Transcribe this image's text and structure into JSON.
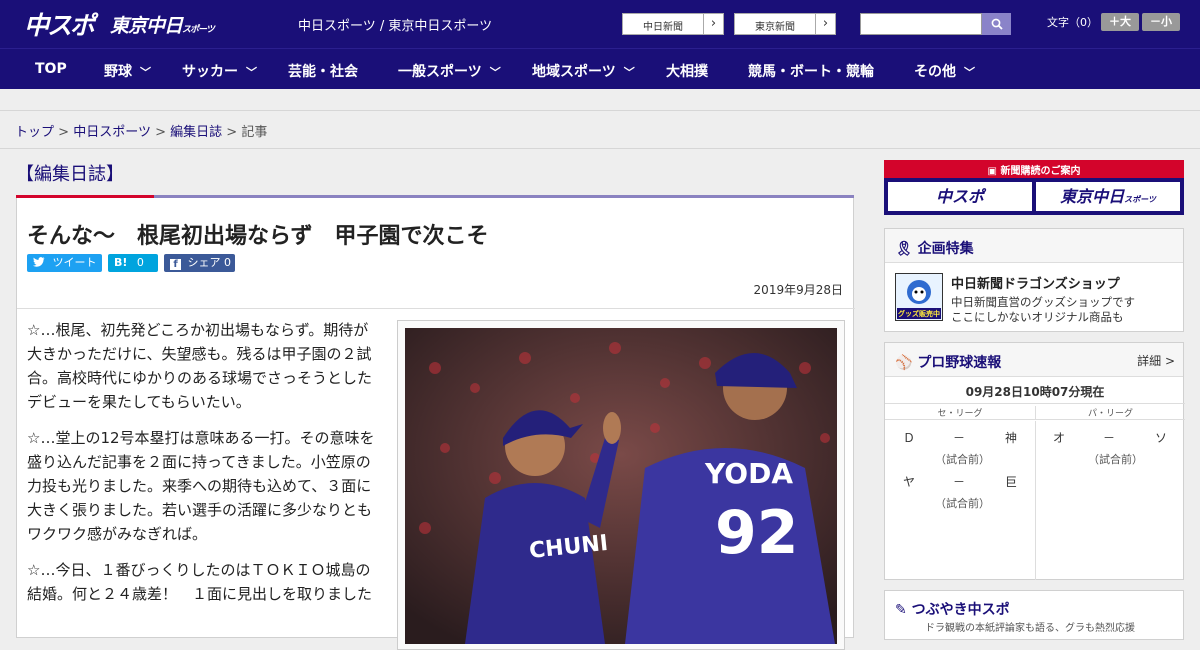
{
  "header": {
    "logo_main": "中スポ",
    "logo_sub": "東京中日",
    "logo_sub_small": "スポーツ",
    "tagline": "中日スポーツ / 東京中日スポーツ",
    "paper_buttons": [
      "中日新聞",
      "東京新聞"
    ],
    "search_placeholder": "",
    "font_size_label": "文字（0）",
    "font_larger": "＋大",
    "font_smaller": "－小"
  },
  "nav": {
    "items": [
      {
        "label": "TOP",
        "dropdown": false
      },
      {
        "label": "野球",
        "dropdown": true
      },
      {
        "label": "サッカー",
        "dropdown": true
      },
      {
        "label": "芸能・社会",
        "dropdown": false
      },
      {
        "label": "一般スポーツ",
        "dropdown": true
      },
      {
        "label": "地域スポーツ",
        "dropdown": true
      },
      {
        "label": "大相撲",
        "dropdown": false
      },
      {
        "label": "競馬・ボート・競輪",
        "dropdown": false
      },
      {
        "label": "その他",
        "dropdown": true
      }
    ]
  },
  "breadcrumb": {
    "top": "トップ",
    "sep": ">",
    "site": "中日スポーツ",
    "section": "編集日誌",
    "current": "記事"
  },
  "article": {
    "section_title": "【編集日誌】",
    "headline": "そんな～　根尾初出場ならず　甲子園で次こそ",
    "share": {
      "tweet": "ツイート",
      "hatena_label": "B!",
      "hatena_count": "0",
      "facebook_label": "シェア",
      "facebook_count": "0"
    },
    "date": "2019年9月28日",
    "paragraphs": [
      "☆…根尾、初先発どころか初出場もならず。期待が大きかっただけに、失望感も。残るは甲子園の２試合。高校時代にゆかりのある球場でさっそうとしたデビューを果たしてもらいたい。",
      "☆…堂上の12号本塁打は意味ある一打。その意味を盛り込んだ記事を２面に持ってきました。小笠原の力投も光りました。来季への期待も込めて、３面に大きく張りました。若い選手の活躍に多少なりともワクワク感がみなぎれば。",
      "☆…今日、１番びっくりしたのはＴＯＫＩＯ城島の結婚。何と２４歳差！　１面に見出しを取りました"
    ],
    "photo": {
      "jersey_name": "YODA",
      "jersey_number": "92",
      "front_text": "CHUNI"
    }
  },
  "sidebar": {
    "subscribe_title": "新聞購読のご案内",
    "subscribe_buttons": [
      "中スポ",
      "東京中日"
    ],
    "subscribe_small": "スポーツ",
    "special": {
      "title": "企画特集",
      "shop_title": "中日新聞ドラゴンズショップ",
      "shop_lines": [
        "中日新聞直営のグッズショップです",
        "ここにしかないオリジナル商品も"
      ],
      "shop_badge": "グッズ販売中"
    },
    "scores": {
      "title": "プロ野球速報",
      "detail": "詳細 >",
      "timestamp": "09月28日10時07分現在",
      "central": "セ・リーグ",
      "pacific": "パ・リーグ",
      "games": [
        {
          "home": "Ｄ",
          "sep": "－",
          "away": "神",
          "status": "（試合前）"
        },
        {
          "home": "ヤ",
          "sep": "－",
          "away": "巨",
          "status": "（試合前）"
        },
        {
          "home": "オ",
          "sep": "－",
          "away": "ソ",
          "status": "（試合前）"
        }
      ]
    },
    "tweets": {
      "title": "つぶやき中スポ",
      "sub": "ドラ観戦の本紙評論家も語る、グラも熱烈応援"
    }
  },
  "colors": {
    "brand": "#1a0f78",
    "accent_red": "#d3042b",
    "twitter": "#1da1f2",
    "facebook": "#3b5998"
  }
}
